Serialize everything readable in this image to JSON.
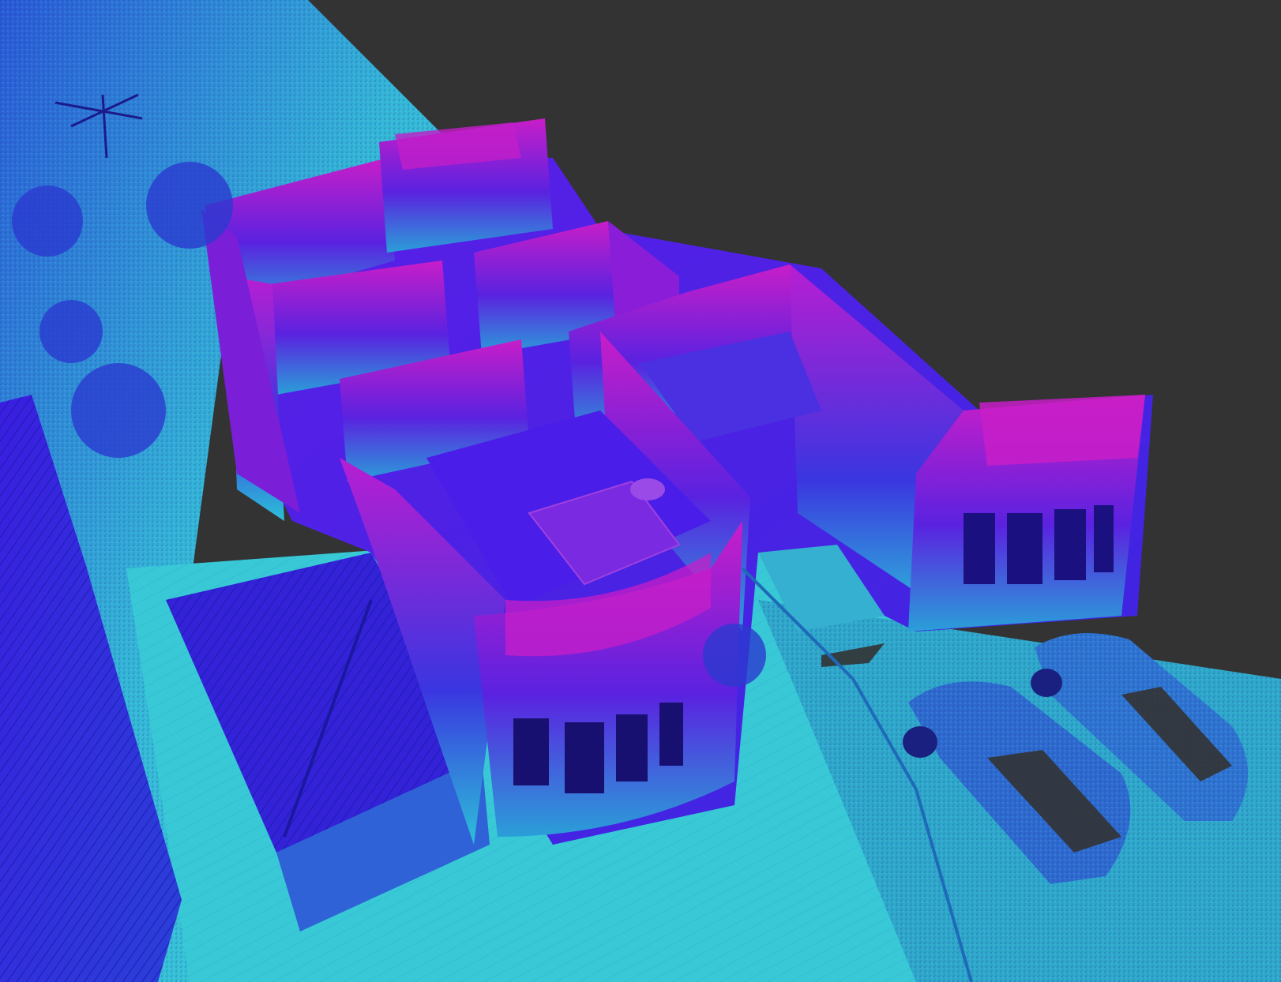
{
  "viewer": {
    "background_color": "#333333",
    "colormap": {
      "name": "height-cyan-blue-magenta",
      "low": "#3fd6d6",
      "mid": "#3a2ee0",
      "high": "#c81ec8"
    }
  },
  "scene": {
    "subject": "point-cloud-house-scan",
    "elements": [
      "ground",
      "trees",
      "house-walls",
      "rooms",
      "bed",
      "bay-windows",
      "neighbor-roof",
      "garage-roof",
      "street",
      "parked-cars"
    ]
  }
}
